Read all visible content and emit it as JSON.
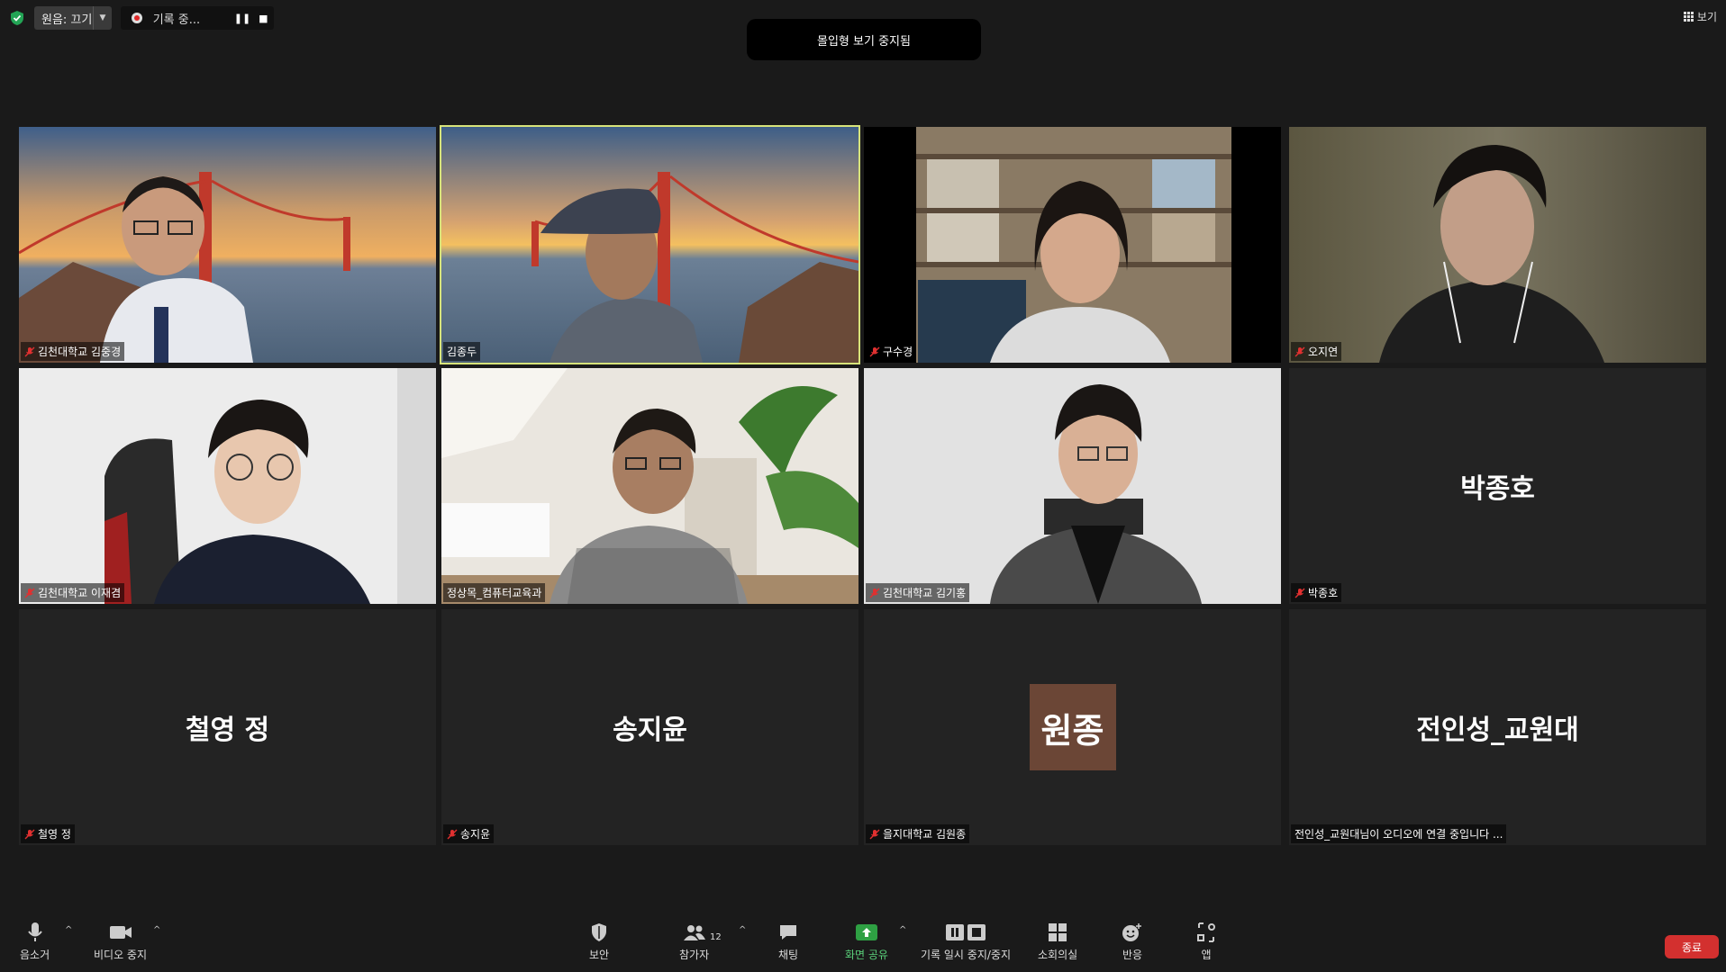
{
  "topbar": {
    "audio_label": "원음: 끄기",
    "recording_label": "기록 중...",
    "immersive_text": "몰입형 보기 중지됨",
    "view_label": "보기"
  },
  "tiles": [
    {
      "name": "김천대학교 김중경",
      "muted": true,
      "kind": "video"
    },
    {
      "name": "김종두",
      "muted": false,
      "kind": "video",
      "active": true
    },
    {
      "name": "구수경",
      "muted": true,
      "kind": "video"
    },
    {
      "name": "오지연",
      "muted": true,
      "kind": "video"
    },
    {
      "name": "김천대학교 이재겸",
      "muted": true,
      "kind": "video"
    },
    {
      "name": "정상목_컴퓨터교육과",
      "muted": false,
      "kind": "video"
    },
    {
      "name": "김천대학교 김기홍",
      "muted": true,
      "kind": "video"
    },
    {
      "name": "박종호",
      "muted": true,
      "kind": "name",
      "display": "박종호"
    },
    {
      "name": "철영 정",
      "muted": true,
      "kind": "name",
      "display": "철영 정"
    },
    {
      "name": "송지윤",
      "muted": true,
      "kind": "name",
      "display": "송지윤"
    },
    {
      "name": "을지대학교 김원종",
      "muted": true,
      "kind": "avatar",
      "display": "원종"
    },
    {
      "name": "전인성_교원대님이 오디오에 연결 중입니다 ...",
      "muted": false,
      "kind": "name",
      "display": "전인성_교원대"
    }
  ],
  "toolbar": {
    "mute": "음소거",
    "video": "비디오 중지",
    "security": "보안",
    "participants": "참가자",
    "participants_count": "12",
    "chat": "채팅",
    "share": "화면 공유",
    "record": "기록 일시 중지/중지",
    "breakout": "소회의실",
    "reactions": "반응",
    "apps": "앱",
    "end": "종료"
  },
  "colors": {
    "background": "#1a1a1a",
    "active_speaker": "#d7e37a",
    "share_green": "#2ea043",
    "end_red": "#d3302f"
  }
}
